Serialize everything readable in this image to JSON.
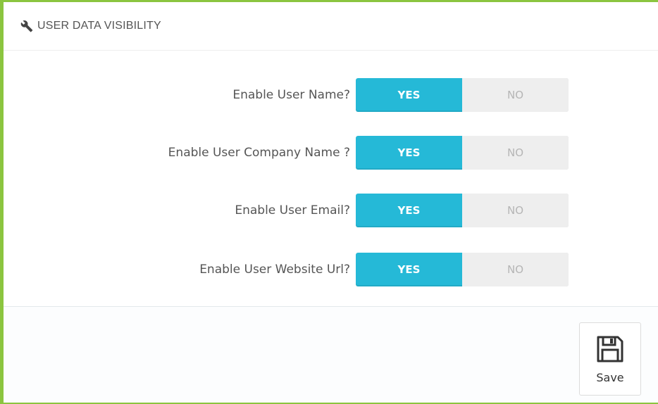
{
  "panel": {
    "heading_icon": "wrench-icon",
    "title": "USER DATA VISIBILITY"
  },
  "settings": [
    {
      "label": "Enable User Name?",
      "yes_label": "YES",
      "no_label": "NO",
      "value": "YES"
    },
    {
      "label": "Enable User Company Name ?",
      "yes_label": "YES",
      "no_label": "NO",
      "value": "YES"
    },
    {
      "label": "Enable User Email?",
      "yes_label": "YES",
      "no_label": "NO",
      "value": "YES"
    },
    {
      "label": "Enable User Website Url?",
      "yes_label": "YES",
      "no_label": "NO",
      "value": "YES"
    }
  ],
  "footer": {
    "save_icon": "floppy-disk-icon",
    "save_label": "Save"
  },
  "colors": {
    "panel_border": "#8bc53f",
    "switch_active": "#25b9d7",
    "switch_inactive": "#eeeeee"
  }
}
